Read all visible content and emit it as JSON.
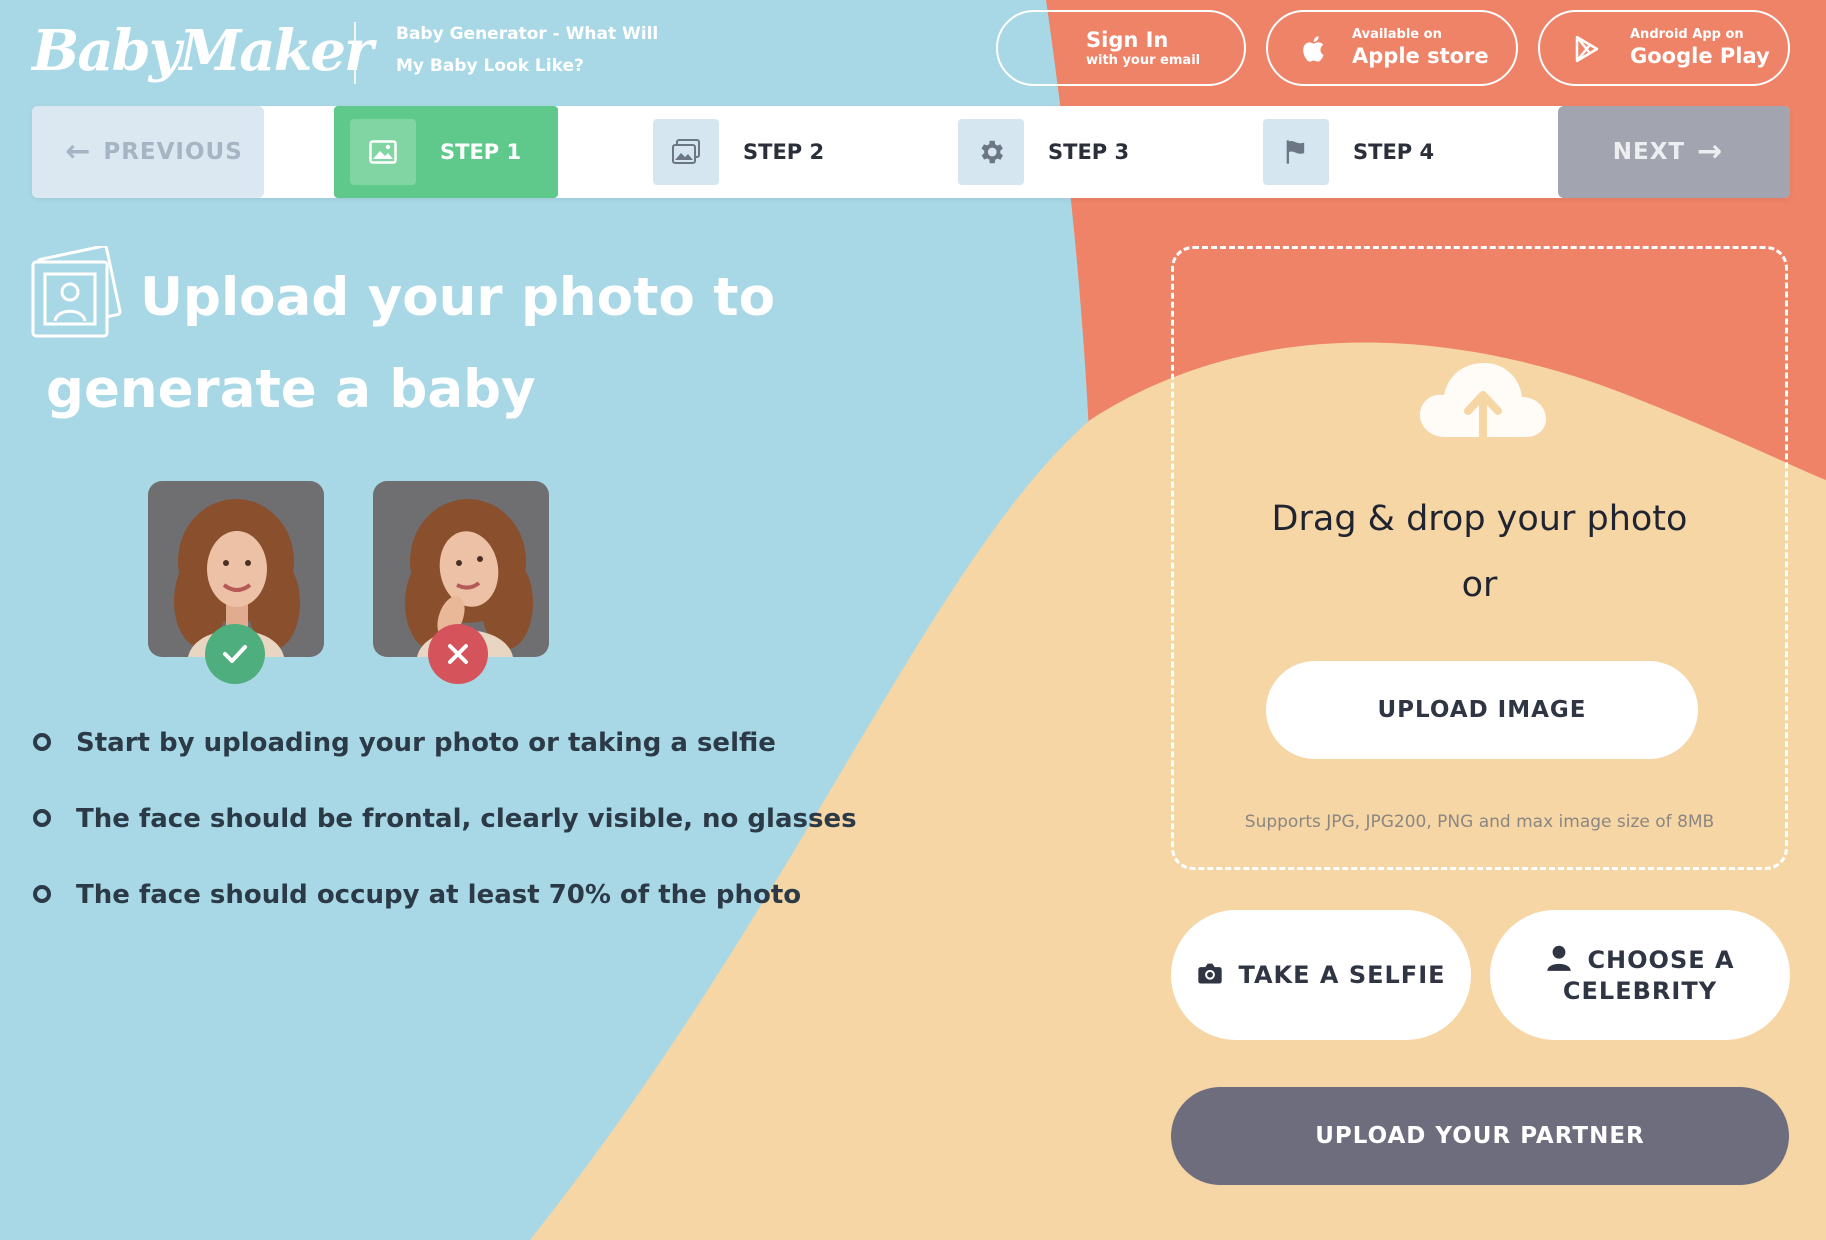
{
  "brand": {
    "logo_text": "BabyMaker",
    "tagline": "Baby Generator - What Will My Baby Look Like?"
  },
  "header": {
    "signin": {
      "title": "Sign In",
      "subtitle": "with your email"
    },
    "apple": {
      "small": "Available on",
      "big": "Apple store"
    },
    "google": {
      "small": "Android App on",
      "big": "Google Play"
    }
  },
  "stepbar": {
    "previous": "PREVIOUS",
    "next": "NEXT",
    "steps": [
      {
        "label": "STEP 1",
        "icon": "image-icon",
        "active": true
      },
      {
        "label": "STEP 2",
        "icon": "images-icon",
        "active": false
      },
      {
        "label": "STEP 3",
        "icon": "gear-icon",
        "active": false
      },
      {
        "label": "STEP 4",
        "icon": "flag-icon",
        "active": false
      }
    ]
  },
  "main": {
    "title": "Upload your photo to generate a baby",
    "examples": [
      {
        "type": "good",
        "icon": "check-icon"
      },
      {
        "type": "bad",
        "icon": "close-icon"
      }
    ],
    "tips": [
      "Start by uploading your photo or taking a selfie",
      "The face should be frontal, clearly visible, no glasses",
      "The face should occupy at least 70% of the photo"
    ]
  },
  "upload": {
    "drag_text": "Drag & drop your photo",
    "or_text": "or",
    "button": "UPLOAD IMAGE",
    "note": "Supports JPG, JPG200, PNG and max image size of 8MB",
    "selfie_button": "TAKE A SELFIE",
    "celebrity_button": "CHOOSE A CELEBRITY",
    "partner_button": "UPLOAD YOUR PARTNER"
  },
  "colors": {
    "sky": "#a8d8e6",
    "coral": "#ef8368",
    "peach": "#f6d6a5",
    "green": "#5ec98a",
    "dark_button": "#6e6d7e"
  }
}
